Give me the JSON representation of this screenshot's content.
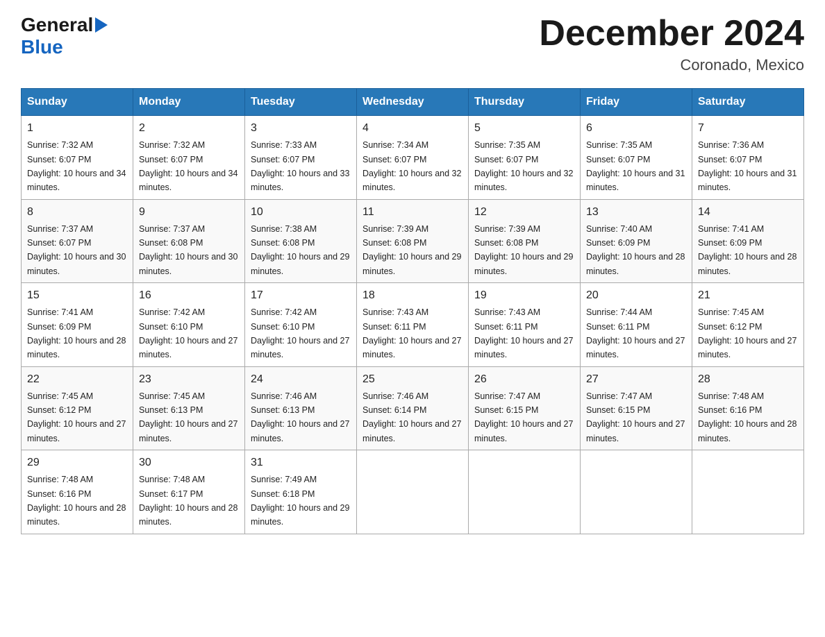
{
  "logo": {
    "general": "General",
    "blue": "Blue",
    "triangle": "▶"
  },
  "title": "December 2024",
  "location": "Coronado, Mexico",
  "days": [
    "Sunday",
    "Monday",
    "Tuesday",
    "Wednesday",
    "Thursday",
    "Friday",
    "Saturday"
  ],
  "weeks": [
    [
      {
        "day": 1,
        "sunrise": "7:32 AM",
        "sunset": "6:07 PM",
        "daylight": "10 hours and 34 minutes."
      },
      {
        "day": 2,
        "sunrise": "7:32 AM",
        "sunset": "6:07 PM",
        "daylight": "10 hours and 34 minutes."
      },
      {
        "day": 3,
        "sunrise": "7:33 AM",
        "sunset": "6:07 PM",
        "daylight": "10 hours and 33 minutes."
      },
      {
        "day": 4,
        "sunrise": "7:34 AM",
        "sunset": "6:07 PM",
        "daylight": "10 hours and 32 minutes."
      },
      {
        "day": 5,
        "sunrise": "7:35 AM",
        "sunset": "6:07 PM",
        "daylight": "10 hours and 32 minutes."
      },
      {
        "day": 6,
        "sunrise": "7:35 AM",
        "sunset": "6:07 PM",
        "daylight": "10 hours and 31 minutes."
      },
      {
        "day": 7,
        "sunrise": "7:36 AM",
        "sunset": "6:07 PM",
        "daylight": "10 hours and 31 minutes."
      }
    ],
    [
      {
        "day": 8,
        "sunrise": "7:37 AM",
        "sunset": "6:07 PM",
        "daylight": "10 hours and 30 minutes."
      },
      {
        "day": 9,
        "sunrise": "7:37 AM",
        "sunset": "6:08 PM",
        "daylight": "10 hours and 30 minutes."
      },
      {
        "day": 10,
        "sunrise": "7:38 AM",
        "sunset": "6:08 PM",
        "daylight": "10 hours and 29 minutes."
      },
      {
        "day": 11,
        "sunrise": "7:39 AM",
        "sunset": "6:08 PM",
        "daylight": "10 hours and 29 minutes."
      },
      {
        "day": 12,
        "sunrise": "7:39 AM",
        "sunset": "6:08 PM",
        "daylight": "10 hours and 29 minutes."
      },
      {
        "day": 13,
        "sunrise": "7:40 AM",
        "sunset": "6:09 PM",
        "daylight": "10 hours and 28 minutes."
      },
      {
        "day": 14,
        "sunrise": "7:41 AM",
        "sunset": "6:09 PM",
        "daylight": "10 hours and 28 minutes."
      }
    ],
    [
      {
        "day": 15,
        "sunrise": "7:41 AM",
        "sunset": "6:09 PM",
        "daylight": "10 hours and 28 minutes."
      },
      {
        "day": 16,
        "sunrise": "7:42 AM",
        "sunset": "6:10 PM",
        "daylight": "10 hours and 27 minutes."
      },
      {
        "day": 17,
        "sunrise": "7:42 AM",
        "sunset": "6:10 PM",
        "daylight": "10 hours and 27 minutes."
      },
      {
        "day": 18,
        "sunrise": "7:43 AM",
        "sunset": "6:11 PM",
        "daylight": "10 hours and 27 minutes."
      },
      {
        "day": 19,
        "sunrise": "7:43 AM",
        "sunset": "6:11 PM",
        "daylight": "10 hours and 27 minutes."
      },
      {
        "day": 20,
        "sunrise": "7:44 AM",
        "sunset": "6:11 PM",
        "daylight": "10 hours and 27 minutes."
      },
      {
        "day": 21,
        "sunrise": "7:45 AM",
        "sunset": "6:12 PM",
        "daylight": "10 hours and 27 minutes."
      }
    ],
    [
      {
        "day": 22,
        "sunrise": "7:45 AM",
        "sunset": "6:12 PM",
        "daylight": "10 hours and 27 minutes."
      },
      {
        "day": 23,
        "sunrise": "7:45 AM",
        "sunset": "6:13 PM",
        "daylight": "10 hours and 27 minutes."
      },
      {
        "day": 24,
        "sunrise": "7:46 AM",
        "sunset": "6:13 PM",
        "daylight": "10 hours and 27 minutes."
      },
      {
        "day": 25,
        "sunrise": "7:46 AM",
        "sunset": "6:14 PM",
        "daylight": "10 hours and 27 minutes."
      },
      {
        "day": 26,
        "sunrise": "7:47 AM",
        "sunset": "6:15 PM",
        "daylight": "10 hours and 27 minutes."
      },
      {
        "day": 27,
        "sunrise": "7:47 AM",
        "sunset": "6:15 PM",
        "daylight": "10 hours and 27 minutes."
      },
      {
        "day": 28,
        "sunrise": "7:48 AM",
        "sunset": "6:16 PM",
        "daylight": "10 hours and 28 minutes."
      }
    ],
    [
      {
        "day": 29,
        "sunrise": "7:48 AM",
        "sunset": "6:16 PM",
        "daylight": "10 hours and 28 minutes."
      },
      {
        "day": 30,
        "sunrise": "7:48 AM",
        "sunset": "6:17 PM",
        "daylight": "10 hours and 28 minutes."
      },
      {
        "day": 31,
        "sunrise": "7:49 AM",
        "sunset": "6:18 PM",
        "daylight": "10 hours and 29 minutes."
      },
      null,
      null,
      null,
      null
    ]
  ]
}
